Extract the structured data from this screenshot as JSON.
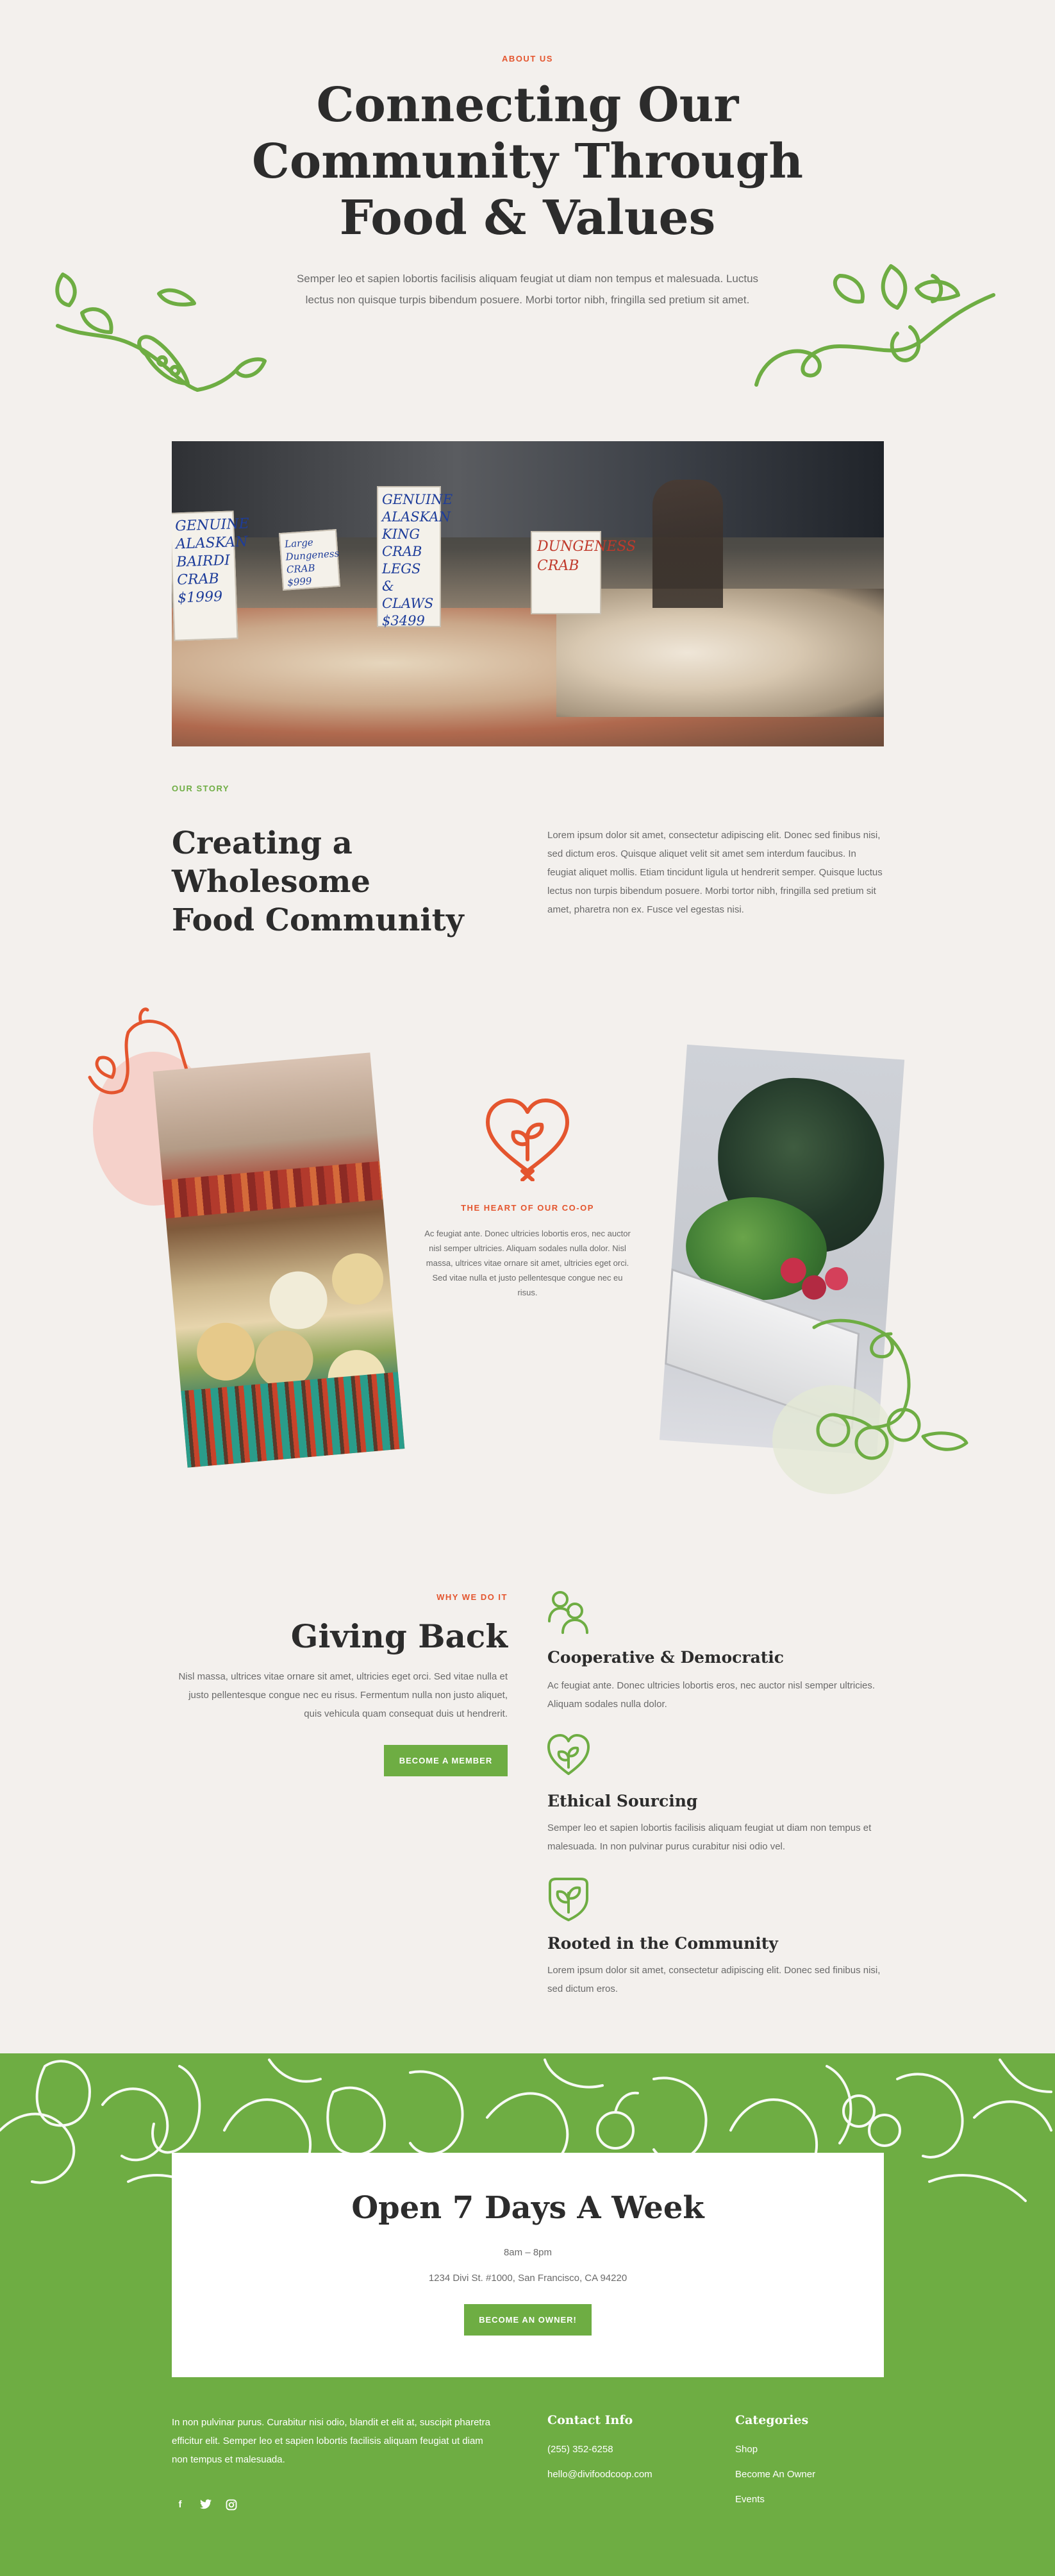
{
  "hero": {
    "eyebrow": "ABOUT US",
    "title_line1": "Connecting Our",
    "title_line2": "Community Through",
    "title_line3": "Food & Values",
    "text": "Semper leo et sapien lobortis facilisis aliquam feugiat ut diam non tempus et malesuada. Luctus lectus non quisque turpis bibendum posuere. Morbi tortor nibh, fringilla sed pretium sit amet."
  },
  "market_photo": {
    "signs": [
      "GENUINE ALASKAN BAIRDI CRAB $1999",
      "Large Dungeness CRAB $999",
      "GENUINE ALASKAN KING CRAB LEGS & CLAWS $3499",
      "DUNGENESS CRAB"
    ]
  },
  "story": {
    "eyebrow": "OUR STORY",
    "title_line1": "Creating a Wholesome",
    "title_line2": "Food Community",
    "text": "Lorem ipsum dolor sit amet, consectetur adipiscing elit. Donec sed finibus nisi, sed dictum eros. Quisque aliquet velit sit amet sem interdum faucibus. In feugiat aliquet mollis. Etiam tincidunt ligula ut hendrerit semper. Quisque luctus lectus non turpis bibendum posuere. Morbi tortor nibh, fringilla sed pretium sit amet, pharetra non ex. Fusce vel egestas nisi."
  },
  "heart": {
    "eyebrow": "THE HEART OF OUR CO-OP",
    "text": "Ac feugiat ante. Donec ultricies lobortis eros, nec auctor nisl semper ultricies. Aliquam sodales nulla dolor. Nisl massa, ultrices vitae ornare sit amet, ultricies eget orci. Sed vitae nulla et justo pellentesque congue nec eu risus."
  },
  "giving": {
    "eyebrow": "WHY WE DO IT",
    "title": "Giving Back",
    "text": "Nisl massa, ultrices vitae ornare sit amet, ultricies eget orci. Sed vitae nulla et justo pellentesque congue nec eu risus. Fermentum nulla non justo aliquet, quis vehicula quam consequat duis ut hendrerit.",
    "button": "BECOME A MEMBER",
    "features": [
      {
        "icon": "people-icon",
        "title": "Cooperative & Democratic",
        "text": "Ac feugiat ante. Donec ultricies lobortis eros, nec auctor nisl semper ultricies. Aliquam sodales nulla dolor."
      },
      {
        "icon": "heart-leaf-icon",
        "title": "Ethical Sourcing",
        "text": "Semper leo et sapien lobortis facilisis aliquam feugiat ut diam non tempus et malesuada. In non pulvinar purus curabitur nisi odio vel."
      },
      {
        "icon": "leaf-shield-icon",
        "title": "Rooted in the Community",
        "text": "Lorem ipsum dolor sit amet, consectetur adipiscing elit. Donec sed finibus nisi, sed dictum eros."
      }
    ]
  },
  "hours": {
    "title": "Open 7 Days A Week",
    "time": "8am – 8pm",
    "address": "1234 Divi St. #1000, San Francisco, CA 94220",
    "button": "BECOME AN OWNER!"
  },
  "footer": {
    "about": "In non pulvinar purus. Curabitur nisi odio, blandit et elit at, suscipit pharetra efficitur elit. Semper leo et sapien lobortis facilisis aliquam feugiat ut diam non tempus et malesuada.",
    "contact_title": "Contact Info",
    "phone": "(255) 352-6258",
    "email": "hello@divifoodcoop.com",
    "categories_title": "Categories",
    "categories": [
      "Shop",
      "Become An Owner",
      "Events"
    ],
    "social": [
      "facebook-icon",
      "twitter-icon",
      "instagram-icon"
    ]
  },
  "colors": {
    "background": "#f3f0ed",
    "green": "#6ead43",
    "red": "#e4552e",
    "heading": "#2c2c2c"
  }
}
